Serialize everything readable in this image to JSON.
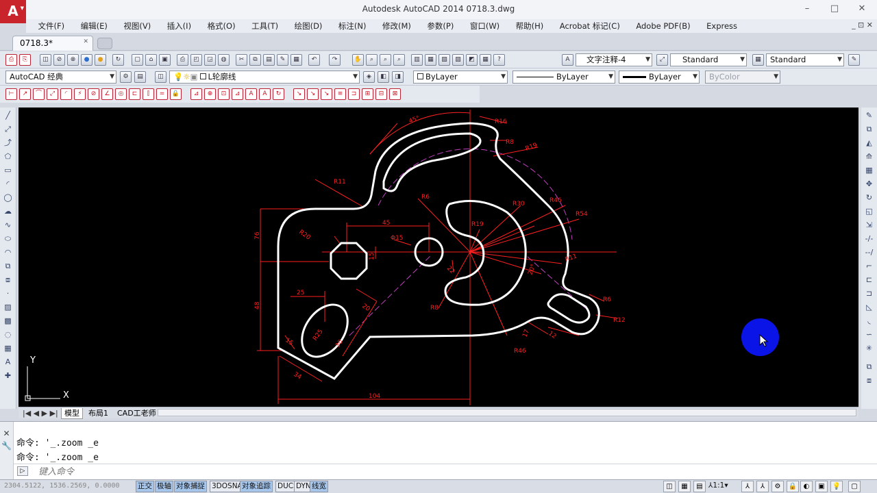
{
  "window": {
    "title": "Autodesk AutoCAD 2014      0718.3.dwg",
    "logo": "A",
    "min": "–",
    "max": "□",
    "close": "✕"
  },
  "menus": [
    "文件(F)",
    "编辑(E)",
    "视图(V)",
    "插入(I)",
    "格式(O)",
    "工具(T)",
    "绘图(D)",
    "标注(N)",
    "修改(M)",
    "参数(P)",
    "窗口(W)",
    "帮助(H)",
    "Acrobat 标记(C)",
    "Adobe PDF(B)",
    "Express"
  ],
  "menu_right": "_ ⊡ ✕",
  "doc_tab": "0718.3*",
  "toolbar1": {
    "annotation_style": "文字注释-4",
    "dim_style": "Standard",
    "table_style": "Standard"
  },
  "toolbar2": {
    "workspace": "AutoCAD 经典",
    "layer": "L轮廓线",
    "color": "ByLayer",
    "linetype": "ByLayer",
    "lineweight": "ByLayer",
    "plotstyle": "ByColor"
  },
  "drawing": {
    "dims": {
      "ang45": "45°",
      "r16": "R16",
      "r8a": "R8",
      "r8b": "R8",
      "r19": "R19",
      "r11a": "R11",
      "r6": "R6",
      "r30": "R30",
      "r46": "R46",
      "r54": "R54",
      "r11b": "R11",
      "r6b": "R6",
      "r12": "R12",
      "r20": "R20",
      "d15": "Φ15",
      "r19b": "R19",
      "r46b": "R46",
      "d45": "45",
      "d15b": "15",
      "d22": "22",
      "d25": "25",
      "d20": "20",
      "d76": "76",
      "d48": "48",
      "d30": "30",
      "d34": "34",
      "d104": "104",
      "ang20": "20°",
      "d10": "10",
      "d17": "17",
      "d12": "12",
      "d15c": "15",
      "r25": "R25"
    },
    "ucs_x": "X",
    "ucs_y": "Y"
  },
  "layout_tabs": [
    "模型",
    "布局1",
    "CAD工老师"
  ],
  "command": {
    "lines": [
      "命令: '_.zoom _e",
      "命令: '_.zoom _e"
    ],
    "placeholder": "键入命令"
  },
  "status": {
    "coords": "2304.5122, 1536.2569, 0.0000",
    "buttons": [
      "正交",
      "极轴",
      "对象捕捉",
      "3DOSNAP",
      "对象追踪",
      "DUCS",
      "DYN",
      "线宽"
    ],
    "scale": "1:1"
  },
  "colors": {
    "outline": "#ffffff",
    "dim": "#ff2020",
    "center": "#c040c0",
    "background": "#000000"
  }
}
